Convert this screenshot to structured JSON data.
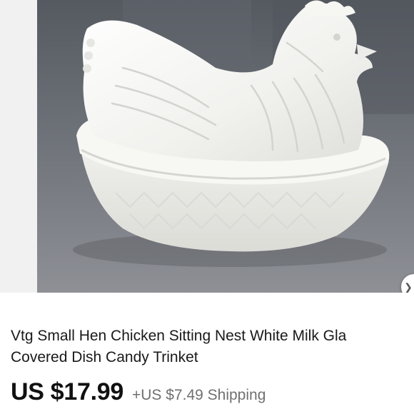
{
  "listing": {
    "title_line1": "Vtg Small Hen Chicken Sitting Nest White Milk Gla",
    "title_line2": "Covered Dish Candy Trinket",
    "price": "US $17.99",
    "shipping": "+US $7.49 Shipping"
  },
  "icons": {
    "next_photo": "chevron-right-icon"
  },
  "colors": {
    "price_text": "#111111",
    "shipping_text": "#707070",
    "photo_backdrop": "#5c6067",
    "milk_glass": "#eeeeea"
  }
}
